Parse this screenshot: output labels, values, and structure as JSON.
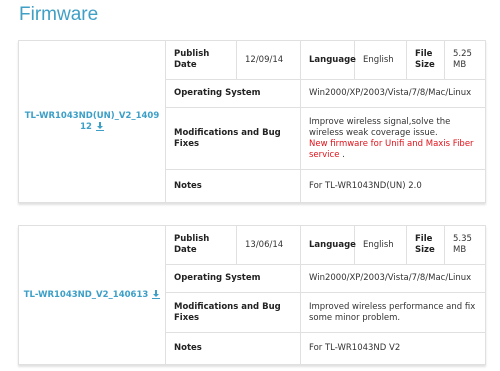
{
  "page": {
    "title": "Firmware"
  },
  "labels": {
    "publish_date": "Publish Date",
    "language": "Language",
    "file_size": "File Size",
    "operating_system": "Operating System",
    "modifications": "Modifications and Bug Fixes",
    "notes": "Notes"
  },
  "firmware": [
    {
      "file_name": "TL-WR1043ND(UN)_V2_140912",
      "publish_date": "12/09/14",
      "language": "English",
      "file_size": "5.25 MB",
      "operating_system": "Win2000/XP/2003/Vista/7/8/Mac/Linux",
      "modifications_line1": "Improve wireless signal,solve the wireless weak coverage issue.",
      "modifications_line2_prefix": "New firmware for ",
      "modifications_line2_link": "Unifi and Maxis Fiber service",
      "modifications_line2_suffix": " .",
      "notes": "For TL-WR1043ND(UN) 2.0"
    },
    {
      "file_name": "TL-WR1043ND_V2_140613",
      "publish_date": "13/06/14",
      "language": "English",
      "file_size": "5.35 MB",
      "operating_system": "Win2000/XP/2003/Vista/7/8/Mac/Linux",
      "modifications": "Improved wireless performance and fix some minor problem.",
      "notes": "For TL-WR1043ND V2"
    }
  ],
  "colors": {
    "accent": "#3f9fc5",
    "link": "#3c9fc7",
    "highlight_red": "#e0131a",
    "border": "#e0e0e0"
  },
  "icons": {
    "download": "download-arrow-icon"
  }
}
